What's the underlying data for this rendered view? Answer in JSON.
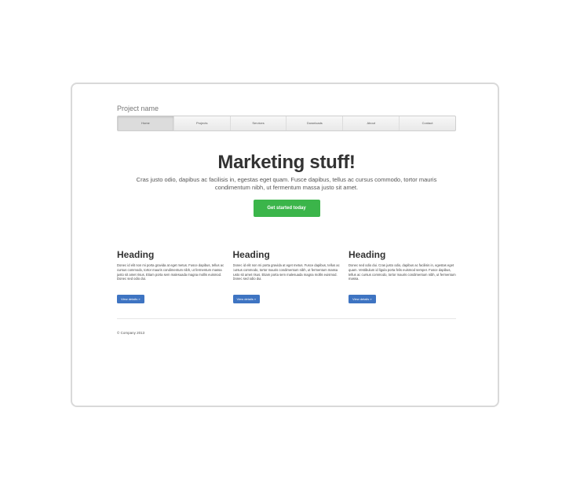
{
  "project_name": "Project name",
  "nav": [
    "Home",
    "Projects",
    "Services",
    "Downloads",
    "About",
    "Contact"
  ],
  "hero": {
    "title": "Marketing stuff!",
    "lead": "Cras justo odio, dapibus ac facilisis in, egestas eget quam. Fusce dapibus, tellus ac cursus commodo, tortor mauris condimentum nibh, ut fermentum massa justo sit amet.",
    "cta": "Get started today"
  },
  "columns": [
    {
      "heading": "Heading",
      "text": "Donec id elit non mi porta gravida at eget metus. Fusce dapibus, tellus ac cursus commodo, tortor mauris condimentum nibh, ut fermentum massa justo sit amet risus. Etiam porta sem malesuada magna mollis euismod. Donec sed odio dui.",
      "button": "View details »"
    },
    {
      "heading": "Heading",
      "text": "Donec id elit non mi porta gravida at eget metus. Fusce dapibus, tellus ac cursus commodo, tortor mauris condimentum nibh, ut fermentum massa justo sit amet risus. Etiam porta sem malesuada magna mollis euismod. Donec sed odio dui.",
      "button": "View details »"
    },
    {
      "heading": "Heading",
      "text": "Donec sed odio dui. Cras justo odio, dapibus ac facilisis in, egestas eget quam. Vestibulum id ligula porta felis euismod semper. Fusce dapibus, tellus ac cursus commodo, tortor mauris condimentum nibh, ut fermentum massa.",
      "button": "View details »"
    }
  ],
  "footer": "© Company 2013",
  "colors": {
    "cta": "#3bb54a",
    "button": "#3e74c2",
    "frame_border": "#d9d9d9"
  }
}
